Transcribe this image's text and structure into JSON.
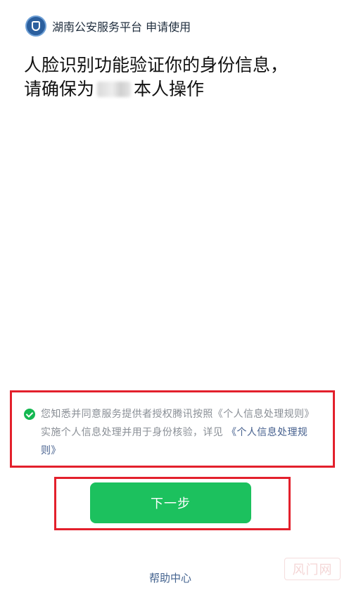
{
  "header": {
    "logo_icon": "police-shield-icon",
    "title": "湖南公安服务平台 申请使用"
  },
  "headline": {
    "line1": "人脸识别功能验证你的身份信息，",
    "line2_prefix": "请确保为",
    "line2_suffix": "本人操作"
  },
  "notice": {
    "check_icon": "check-circle-icon",
    "text": "您知悉并同意服务提供者授权腾讯按照《个人信息处理规则》实施个人信息处理并用于身份核验，详见",
    "link": "《个人信息处理规则》"
  },
  "actions": {
    "next_label": "下一步",
    "help_label": "帮助中心"
  },
  "watermark": {
    "text": "风门网"
  },
  "colors": {
    "accent_green": "#1cc15e",
    "link_blue": "#46608e",
    "highlight_red": "#e3202c"
  }
}
